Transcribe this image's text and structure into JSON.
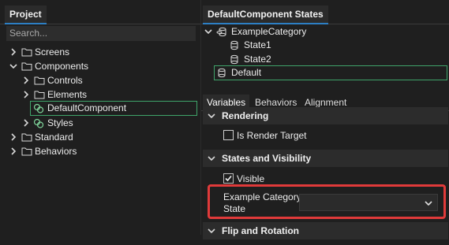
{
  "project": {
    "tab_label": "Project",
    "search_placeholder": "Search...",
    "tree": [
      {
        "label": "Screens"
      },
      {
        "label": "Components"
      },
      {
        "label": "Controls"
      },
      {
        "label": "Elements"
      },
      {
        "label": "DefaultComponent"
      },
      {
        "label": "Styles"
      },
      {
        "label": "Standard"
      },
      {
        "label": "Behaviors"
      }
    ]
  },
  "states": {
    "tab_label": "DefaultComponent States",
    "category": "ExampleCategory",
    "items": [
      "State1",
      "State2"
    ],
    "default_label": "Default"
  },
  "properties": {
    "tabs": [
      "Variables",
      "Behaviors",
      "Alignment"
    ],
    "sections": {
      "rendering": "Rendering",
      "states_visibility": "States and Visibility",
      "flip_rotation": "Flip and Rotation"
    },
    "is_render_target_label": "Is Render Target",
    "is_render_target_checked": false,
    "visible_label": "Visible",
    "visible_checked": true,
    "example_category_label_line1": "Example Category",
    "example_category_label_line2": "State",
    "example_category_value": ""
  },
  "colors": {
    "highlight": "#e03a3a",
    "selection_border": "#3fa46a",
    "tab_accent": "#2d7fc4"
  }
}
